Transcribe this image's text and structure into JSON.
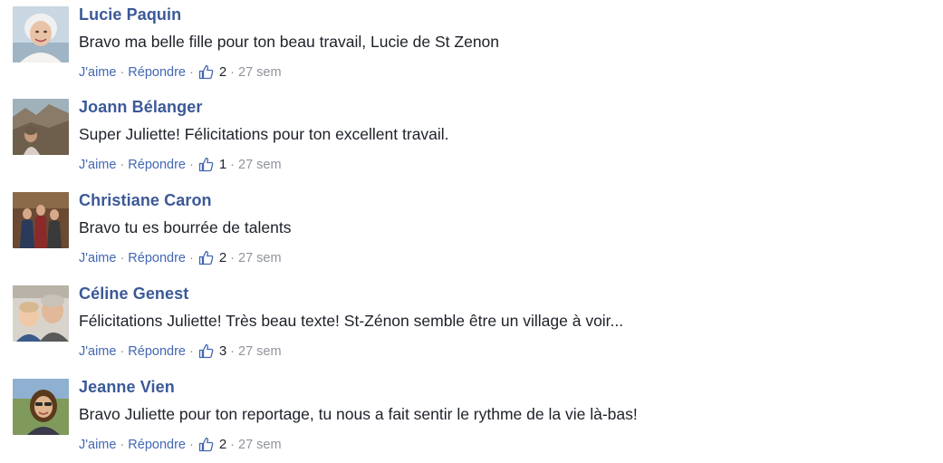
{
  "comments": [
    {
      "author": "Lucie Paquin",
      "text": "Bravo ma belle fille pour ton beau travail, Lucie de St Zenon",
      "like_label": "J'aime",
      "reply_label": "Répondre",
      "like_icon": "thumbs-up-icon",
      "like_count": "2",
      "time": "27 sem",
      "avatar_colors": {
        "bg": "#c9d7e2",
        "face": "#e8c3a8",
        "hair": "#f0f0f0"
      }
    },
    {
      "author": "Joann Bélanger",
      "text": "Super Juliette! Félicitations pour ton excellent travail.",
      "like_label": "J'aime",
      "reply_label": "Répondre",
      "like_icon": "thumbs-up-icon",
      "like_count": "1",
      "time": "27 sem",
      "avatar_colors": {
        "bg": "#8fa0a8",
        "face": "#c49a7a",
        "hair": "#6b5a48"
      }
    },
    {
      "author": "Christiane Caron",
      "text": "Bravo tu es bourrée de talents",
      "like_label": "J'aime",
      "reply_label": "Répondre",
      "like_icon": "thumbs-up-icon",
      "like_count": "2",
      "time": "27 sem",
      "avatar_colors": {
        "bg": "#6a4a32",
        "face": "#d8a88a",
        "hair": "#3a2418"
      }
    },
    {
      "author": "Céline Genest",
      "text": "Félicitations Juliette! Très beau texte! St-Zénon semble être un village à voir...",
      "like_label": "J'aime",
      "reply_label": "Répondre",
      "like_icon": "thumbs-up-icon",
      "like_count": "3",
      "time": "27 sem",
      "avatar_colors": {
        "bg": "#d8d4cc",
        "face": "#e2b89a",
        "hair": "#c9c2b8"
      }
    },
    {
      "author": "Jeanne Vien",
      "text": "Bravo Juliette pour ton reportage, tu nous a fait sentir le rythme de la vie là-bas!",
      "like_label": "J'aime",
      "reply_label": "Répondre",
      "like_icon": "thumbs-up-icon",
      "like_count": "2",
      "time": "27 sem",
      "avatar_colors": {
        "bg": "#7f9a5a",
        "face": "#e0b48c",
        "hair": "#5a3a1c"
      }
    }
  ],
  "separator": "·",
  "colors": {
    "author": "#3b5998",
    "link": "#4267b2",
    "text": "#1d2129",
    "meta": "#90949c"
  }
}
